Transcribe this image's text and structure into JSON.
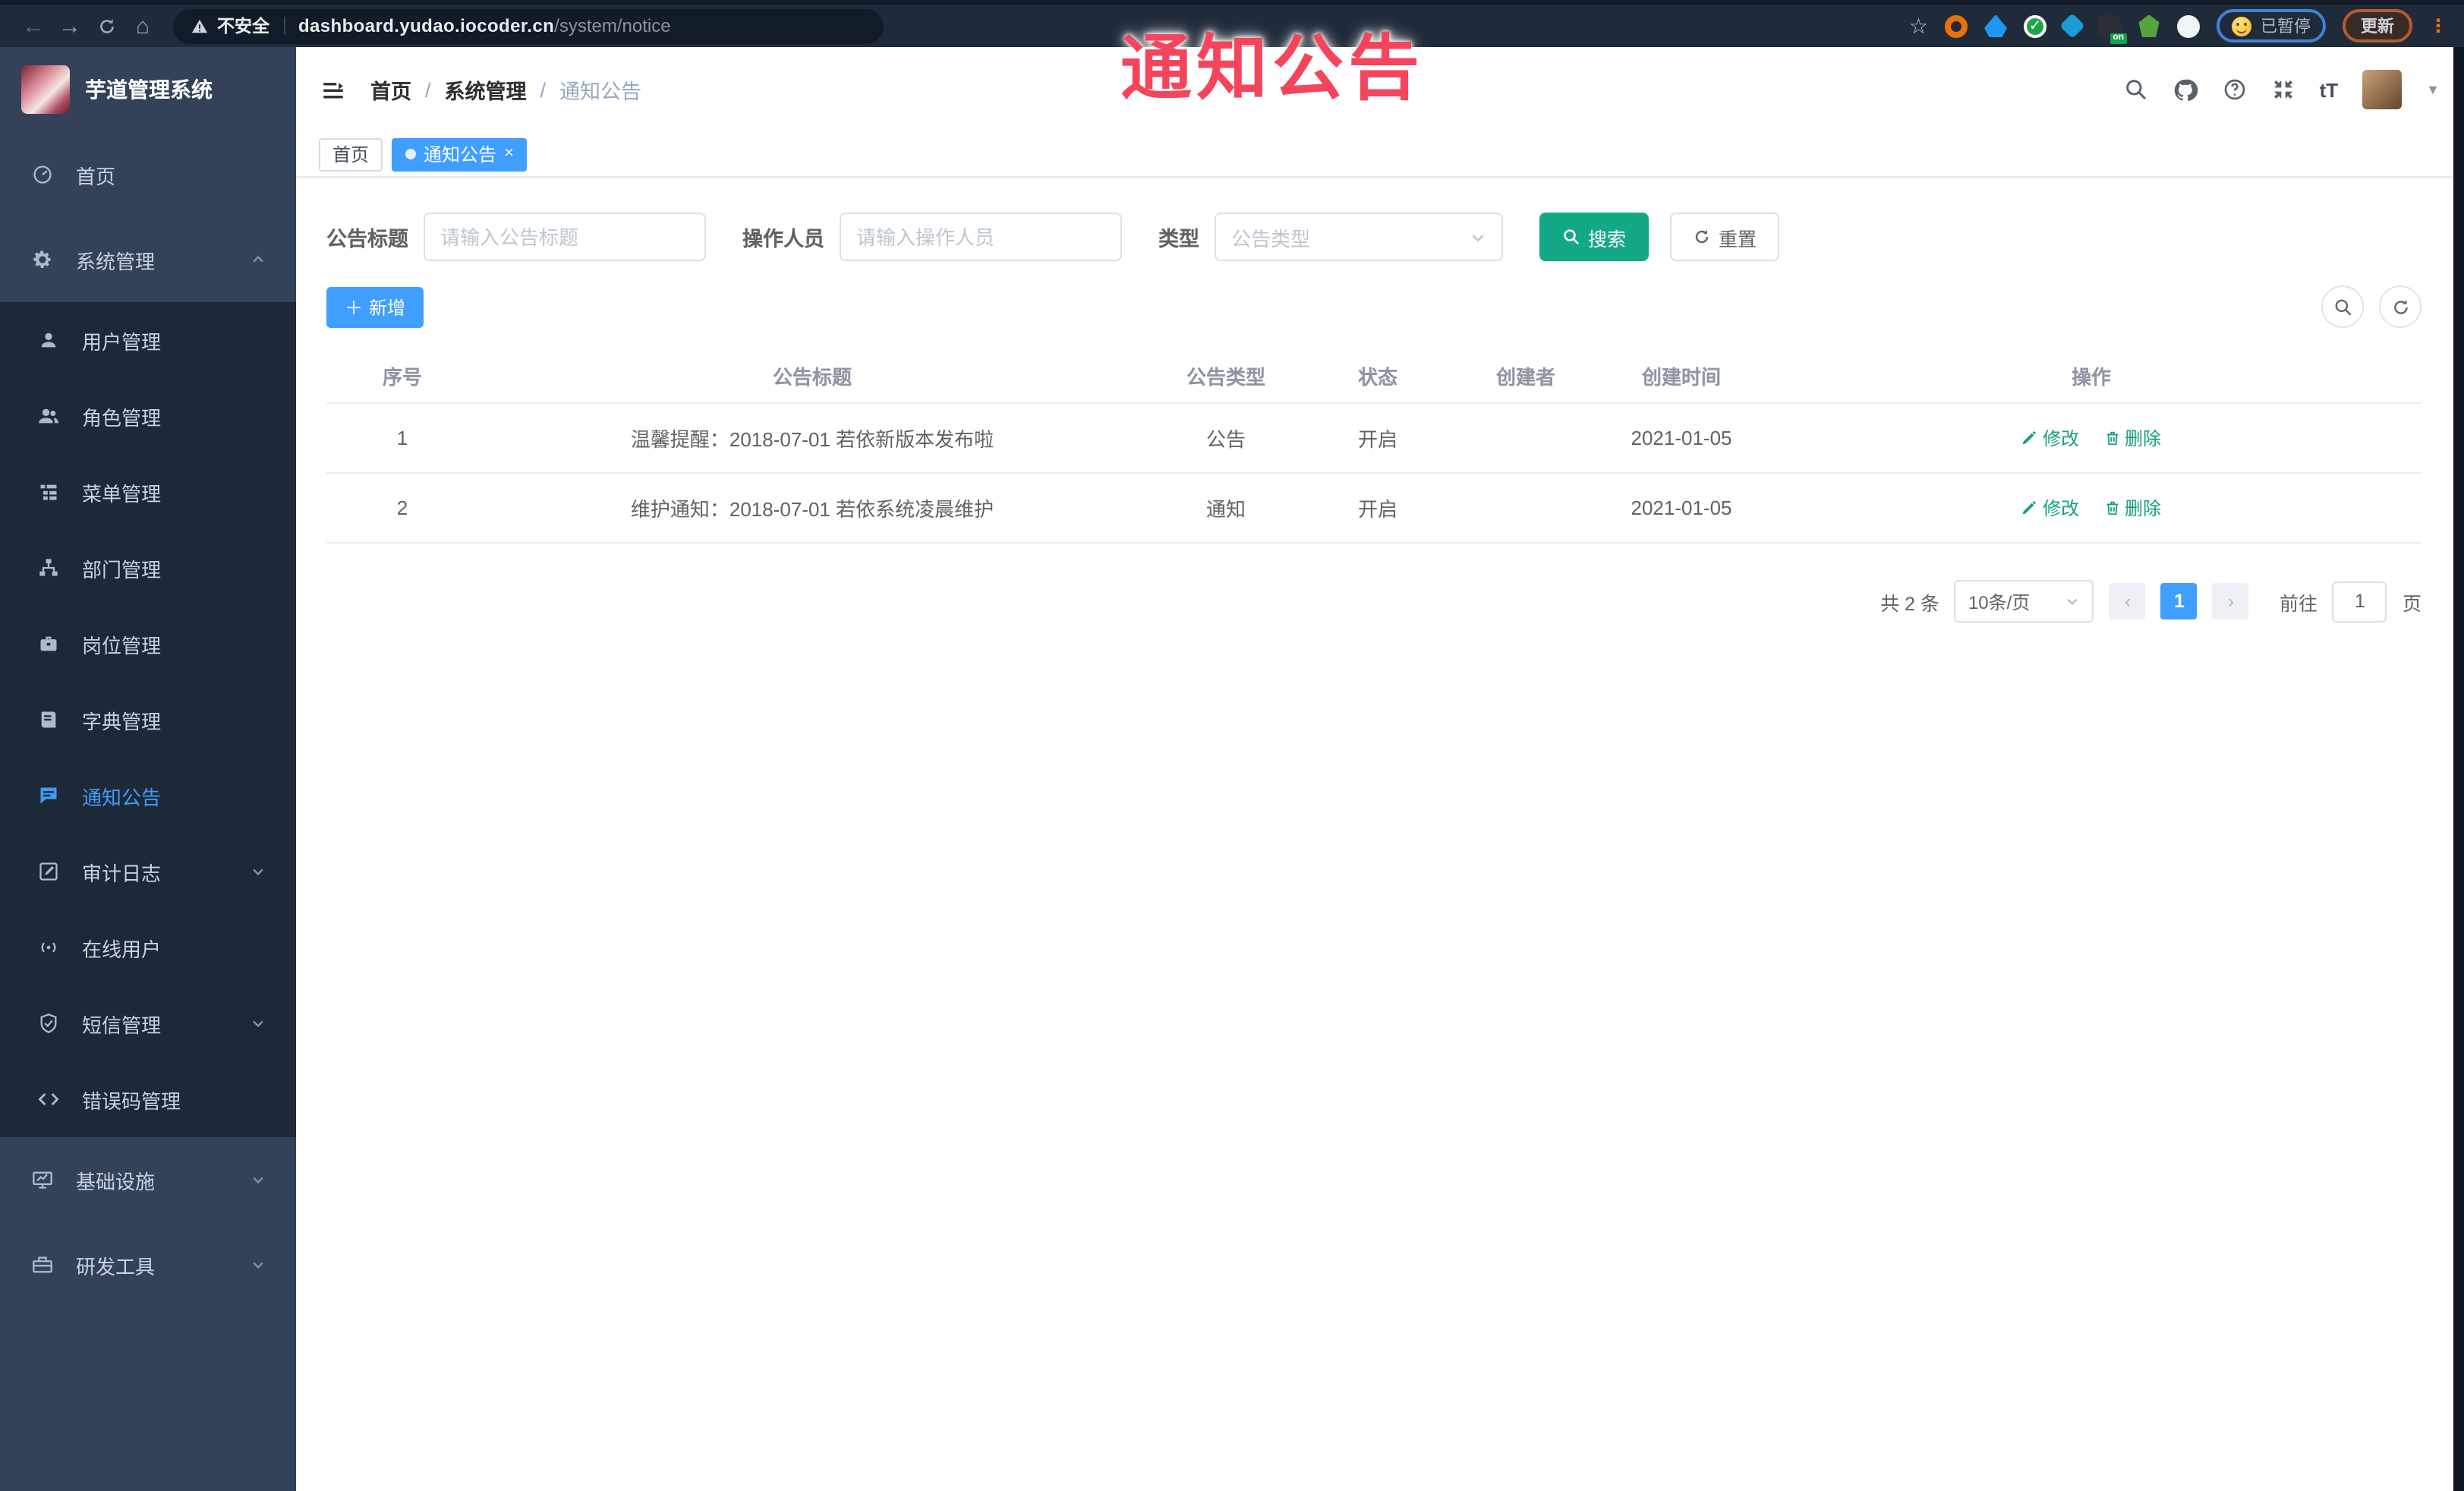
{
  "watermark": "通知公告",
  "browser": {
    "security_label": "不安全",
    "url_host": "dashboard.yudao.iocoder.cn",
    "url_path": "/system/notice",
    "extension_on_badge": "on",
    "paused_label": "已暂停",
    "update_label": "更新"
  },
  "sidebar": {
    "title": "芋道管理系统",
    "items": [
      {
        "label": "首页"
      },
      {
        "label": "系统管理"
      },
      {
        "label": "用户管理"
      },
      {
        "label": "角色管理"
      },
      {
        "label": "菜单管理"
      },
      {
        "label": "部门管理"
      },
      {
        "label": "岗位管理"
      },
      {
        "label": "字典管理"
      },
      {
        "label": "通知公告"
      },
      {
        "label": "审计日志"
      },
      {
        "label": "在线用户"
      },
      {
        "label": "短信管理"
      },
      {
        "label": "错误码管理"
      },
      {
        "label": "基础设施"
      },
      {
        "label": "研发工具"
      }
    ]
  },
  "header": {
    "breadcrumb": [
      "首页",
      "系统管理",
      "通知公告"
    ],
    "font_size_icon_label": "tT"
  },
  "tags": [
    {
      "label": "首页"
    },
    {
      "label": "通知公告"
    }
  ],
  "filters": {
    "title_label": "公告标题",
    "title_placeholder": "请输入公告标题",
    "operator_label": "操作人员",
    "operator_placeholder": "请输入操作人员",
    "type_label": "类型",
    "type_placeholder": "公告类型",
    "search_label": "搜索",
    "reset_label": "重置"
  },
  "toolbar": {
    "add_label": "新增"
  },
  "table": {
    "columns": [
      "序号",
      "公告标题",
      "公告类型",
      "状态",
      "创建者",
      "创建时间",
      "操作"
    ],
    "edit_label": "修改",
    "delete_label": "删除",
    "rows": [
      {
        "index": "1",
        "title": "温馨提醒：2018-07-01 若依新版本发布啦",
        "type": "公告",
        "status": "开启",
        "creator": "",
        "create_time": "2021-01-05"
      },
      {
        "index": "2",
        "title": "维护通知：2018-07-01 若依系统凌晨维护",
        "type": "通知",
        "status": "开启",
        "creator": "",
        "create_time": "2021-01-05"
      }
    ]
  },
  "pagination": {
    "total_label": "共 2 条",
    "page_size_label": "10条/页",
    "current_page": "1",
    "goto_label": "前往",
    "goto_value": "1",
    "page_unit_label": "页"
  },
  "colors": {
    "accent_blue": "#409EFF",
    "theme_teal": "#13A886",
    "link_teal": "#14A083",
    "watermark_red": "#F4455C",
    "sidebar_bg": "#334259",
    "submenu_bg": "#1E2937",
    "browser_bar_bg": "#202B3A"
  }
}
